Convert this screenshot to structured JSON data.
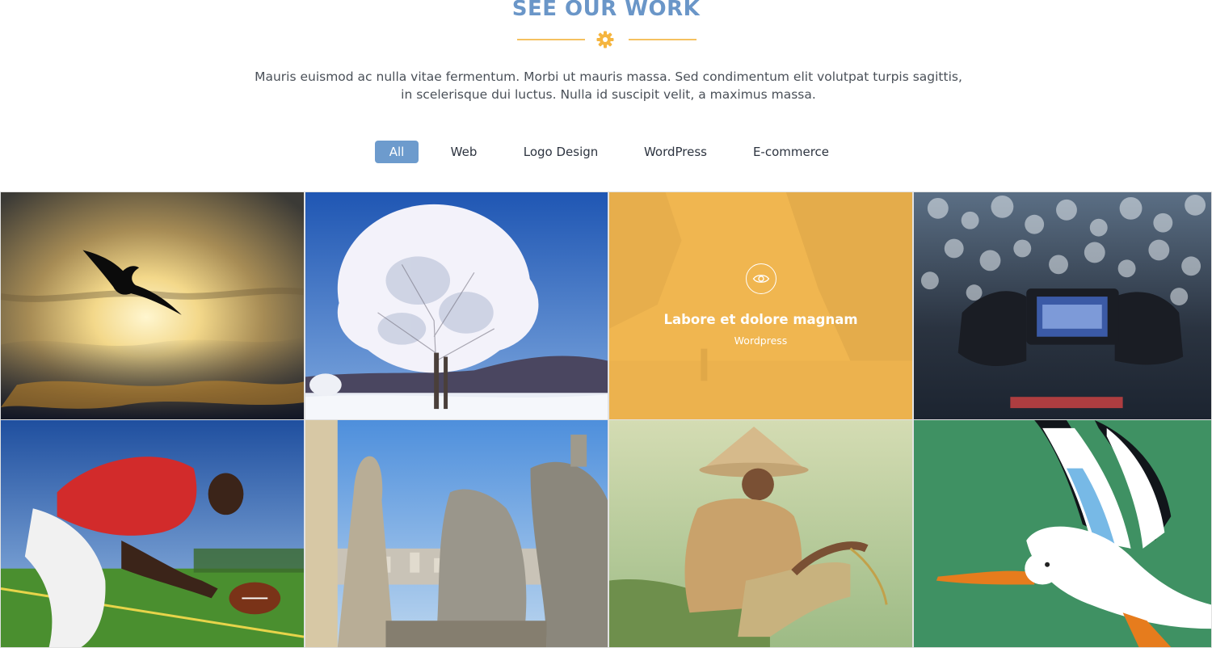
{
  "section": {
    "title": "SEE OUR WORK",
    "intro": "Mauris euismod ac nulla vitae fermentum. Morbi ut mauris massa. Sed condimentum elit volutpat turpis sagittis, in scelerisque dui luctus. Nulla id suscipit velit, a maximus massa."
  },
  "colors": {
    "accent": "#6d9bcd",
    "title": "#6a96c8",
    "divider": "#f5c160",
    "overlay": "#f6b84c"
  },
  "filters": {
    "items": [
      {
        "label": "All",
        "active": true
      },
      {
        "label": "Web",
        "active": false
      },
      {
        "label": "Logo Design",
        "active": false
      },
      {
        "label": "WordPress",
        "active": false
      },
      {
        "label": "E-commerce",
        "active": false
      }
    ]
  },
  "portfolio": {
    "hovered_item": {
      "title": "Labore et dolore magnam",
      "category": "Wordpress",
      "icon": "eye-icon"
    },
    "tiles": [
      {
        "subject": "bird-silhouette-sunset"
      },
      {
        "subject": "frosted-tree"
      },
      {
        "subject": "misty-cliff-photographer"
      },
      {
        "subject": "camera-bokeh-lights"
      },
      {
        "subject": "football-player"
      },
      {
        "subject": "gargoyle-statues"
      },
      {
        "subject": "man-conical-hat"
      },
      {
        "subject": "pelican-illustration"
      }
    ]
  }
}
